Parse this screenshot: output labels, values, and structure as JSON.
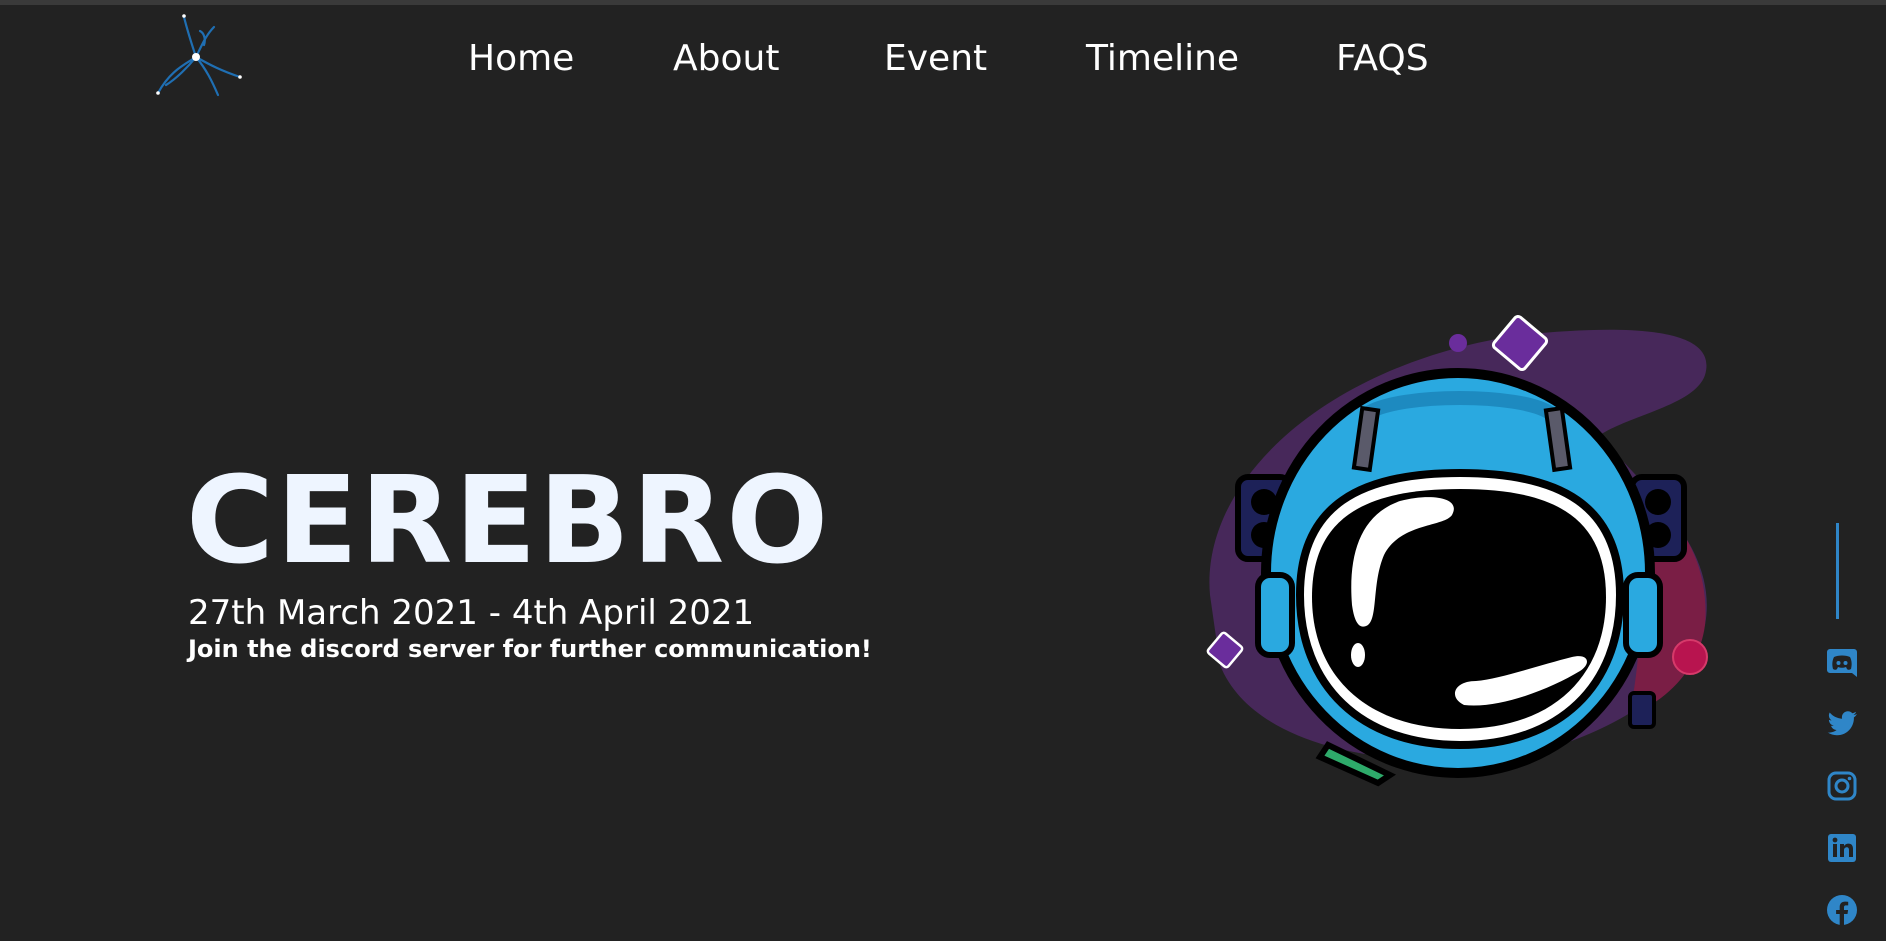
{
  "nav": {
    "items": [
      {
        "label": "Home"
      },
      {
        "label": "About"
      },
      {
        "label": "Event"
      },
      {
        "label": "Timeline"
      },
      {
        "label": "FAQS"
      }
    ]
  },
  "hero": {
    "title": "CEREBRO",
    "dates": "27th March 2021 - 4th April 2021",
    "subtitle": "Join the discord server for further communication!"
  },
  "social": {
    "icons": [
      "discord-icon",
      "twitter-icon",
      "instagram-icon",
      "linkedin-icon",
      "facebook-icon"
    ],
    "accent": "#2f86c8"
  },
  "colors": {
    "background": "#222222",
    "title": "#eef5ff",
    "blob_purple": "#47285a",
    "blob_crimson": "#7a1e45",
    "helmet_blue": "#2aa9e0",
    "diamond_purple": "#6a2d9c"
  }
}
